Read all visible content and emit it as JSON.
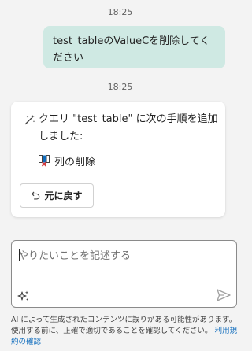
{
  "conversation": {
    "timestamp_user": "18:25",
    "user_message": "test_tableのValueCを削除してください",
    "timestamp_ai": "18:25",
    "ai_message": "クエリ \"test_table\" に次の手順を追加しました:",
    "step_label": "列の削除",
    "undo_label": "元に戻す"
  },
  "composer": {
    "placeholder": "やりたいことを記述する"
  },
  "footer": {
    "disclaimer": "AI によって生成されたコンテンツに誤りがある可能性があります。使用する前に、正確で適切であることを確認してください。",
    "terms_link": "利用規約の確認"
  },
  "icons": {
    "wand": "magic-wand-icon",
    "remove_column": "remove-column-icon",
    "undo": "undo-icon",
    "sparkle": "sparkle-icon",
    "send": "send-icon"
  },
  "colors": {
    "user_bubble": "#cfe9e3",
    "background": "#f3f3f3",
    "link": "#0f6cbd",
    "remove_x": "#d13438",
    "column_blue": "#0f6cbd"
  }
}
